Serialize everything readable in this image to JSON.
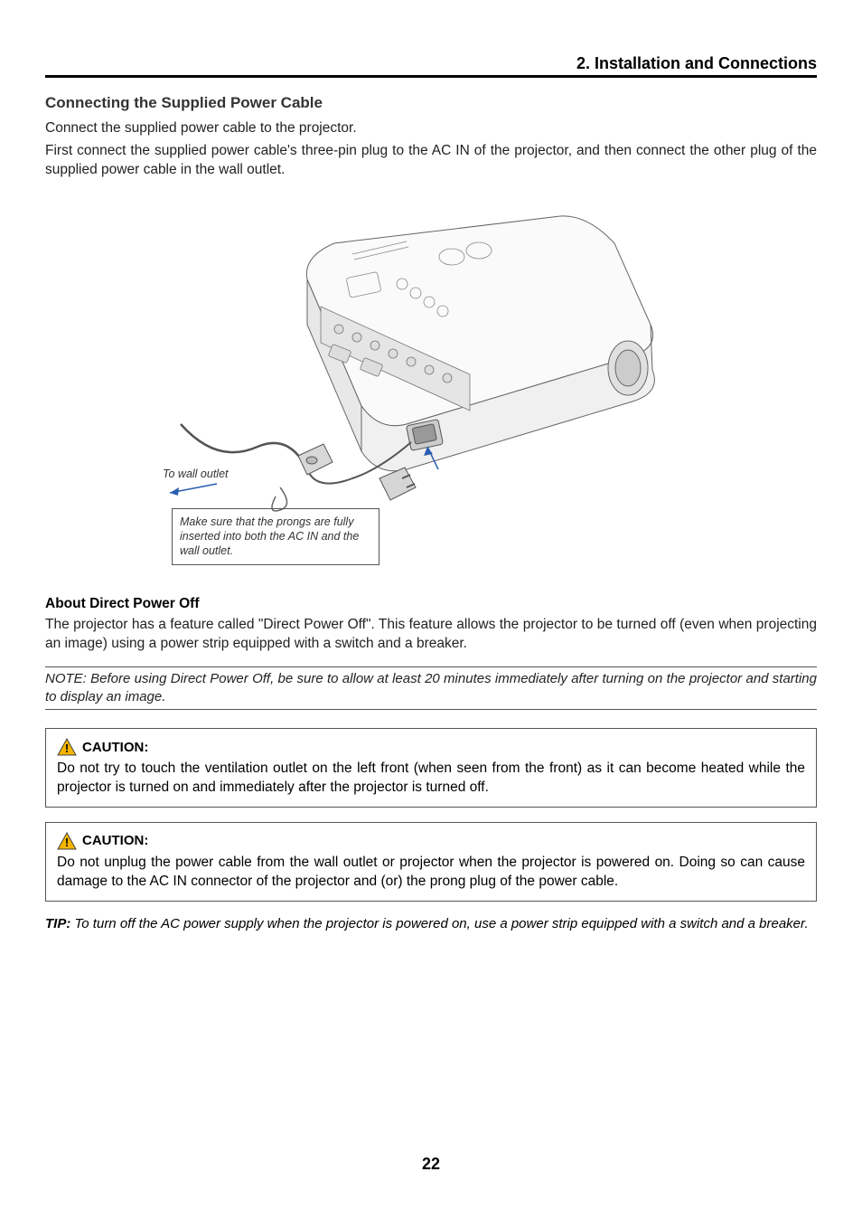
{
  "chapter": "2. Installation and Connections",
  "section_title": "Connecting the Supplied Power Cable",
  "intro_line1": "Connect the supplied power cable to the projector.",
  "intro_line2": "First connect the supplied power cable's three-pin plug to the AC IN of the projector, and then connect the other plug of the supplied power cable in the wall outlet.",
  "diagram": {
    "to_wall_outlet": "To wall outlet",
    "prongs_note": "Make sure that the prongs are fully inserted into both the AC IN and the wall outlet."
  },
  "direct_power_off": {
    "heading": "About Direct Power Off",
    "body": "The projector has a feature called \"Direct Power Off\". This feature allows the projector to be turned off (even when projecting an image) using a power strip equipped with a switch and a breaker."
  },
  "note": "NOTE: Before using Direct Power Off, be sure to allow at least 20 minutes immediately after turning on the projector and starting to display an image.",
  "caution1": {
    "label": "CAUTION:",
    "body": "Do not try to touch the ventilation outlet on the left front (when seen from the front) as it can become heated while the projector is turned on and immediately after the projector is turned off."
  },
  "caution2": {
    "label": "CAUTION:",
    "body": "Do not unplug the power cable from the wall outlet or projector when the projector is powered on. Doing so can cause damage to the AC IN connector of the projector and (or) the prong plug of the power cable."
  },
  "tip": {
    "label": "TIP:",
    "body": " To turn off the AC power supply when the projector is powered on, use a power strip equipped with a switch and a breaker."
  },
  "page_number": "22"
}
